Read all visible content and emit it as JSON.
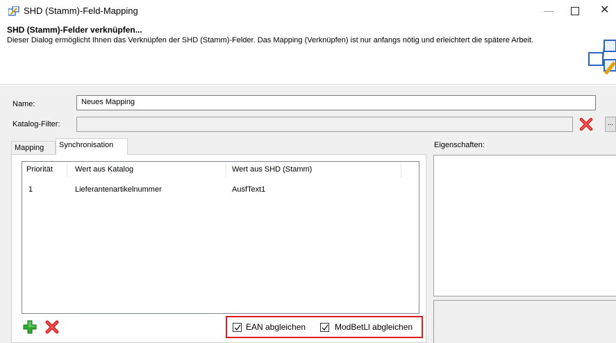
{
  "window": {
    "title": "SHD (Stamm)-Feld-Mapping",
    "min_glyph": "—",
    "close_glyph": "✕"
  },
  "header": {
    "title": "SHD (Stamm)-Felder verknüpfen...",
    "description": "Dieser Dialog ermöglicht Ihnen das Verknüpfen der SHD (Stamm)-Felder. Das Mapping (Verknüpfen) ist nur anfangs nötig und erleichtert die spätere Arbeit."
  },
  "form": {
    "name_label": "Name:",
    "name_value": "Neues Mapping",
    "filter_label": "Katalog-Filter:",
    "filter_value": "",
    "dots_label": "..."
  },
  "tabs": [
    {
      "label": "Mapping"
    },
    {
      "label": "Synchronisation"
    }
  ],
  "list": {
    "columns": [
      "Priorität",
      "Wert aus Katalog",
      "Wert aus SHD (Stamm)"
    ],
    "rows": [
      [
        "1",
        "Lieferantenartikelnummer",
        "AusfText1"
      ]
    ]
  },
  "options": {
    "ean_label": "EAN abgleichen",
    "ean_checked": true,
    "modbet_label": "ModBetLl abgleichen",
    "modbet_checked": true
  },
  "properties": {
    "label": "Eigenschaften:"
  },
  "colors": {
    "highlight": "#e01b1b",
    "add_green": "#2eaa2e",
    "delete_red": "#d42020"
  }
}
